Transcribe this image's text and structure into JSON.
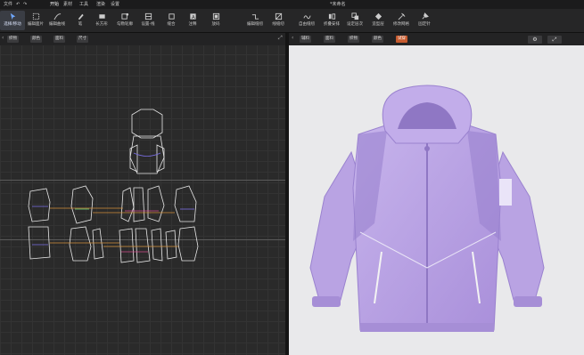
{
  "window": {
    "title": "*未命名"
  },
  "menu": {
    "items": [
      "文件",
      "开始",
      "素材",
      "工具",
      "渲染",
      "设置"
    ]
  },
  "toolbar": {
    "tools": [
      "选择/移动",
      "编辑面片",
      "编辑曲线",
      "笔",
      "长方形",
      "勾勒轮廓",
      "设置-线",
      "缝合",
      "注释",
      "放码",
      "编辑缝纫",
      "线缝纫",
      "自由缝纫",
      "折叠安排",
      "设定层次",
      "造型层",
      "修改网格",
      "固定针"
    ]
  },
  "left_panel": {
    "tabs": [
      "织物",
      "颜色",
      "面料",
      "尺寸"
    ]
  },
  "right_panel": {
    "tabs": [
      "辅料",
      "面料",
      "织物",
      "颜色",
      "试穿"
    ]
  },
  "colors": {
    "accent": "#c65a2e",
    "jacket": "#b9a3e3",
    "jacket_dark": "#9a82cf"
  }
}
